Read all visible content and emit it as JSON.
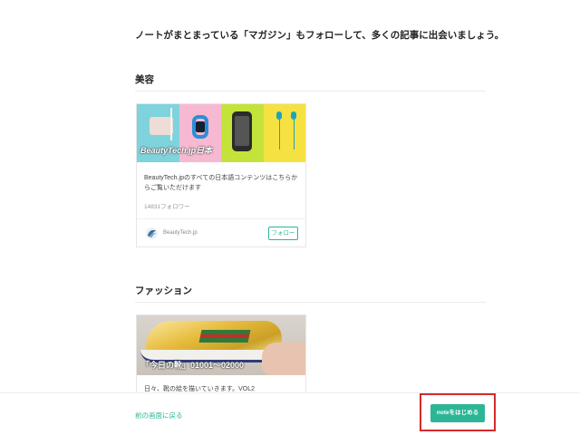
{
  "intro": "ノートがまとまっている「マガジン」もフォローして、多くの記事に出会いましょう。",
  "sections": [
    {
      "heading": "美容",
      "card": {
        "image_caption": "BeautyTech.jp日本",
        "description": "BeautyTech.jpのすべての日本語コンテンツはこちらからご覧いただけます",
        "followers": "14831フォロワー",
        "author": "BeautyTech.jp",
        "follow_label": "フォロー"
      }
    },
    {
      "heading": "ファッション",
      "card": {
        "image_caption": "「今日の靴」01001〜02000",
        "description": "日々、靴の絵を描いていきます。VOL2"
      }
    }
  ],
  "footer": {
    "back_label": "前の画面に戻る",
    "cta_label": "noteをはじめる"
  },
  "colors": {
    "accent": "#2cb696",
    "highlight_frame": "#d62a2a"
  }
}
